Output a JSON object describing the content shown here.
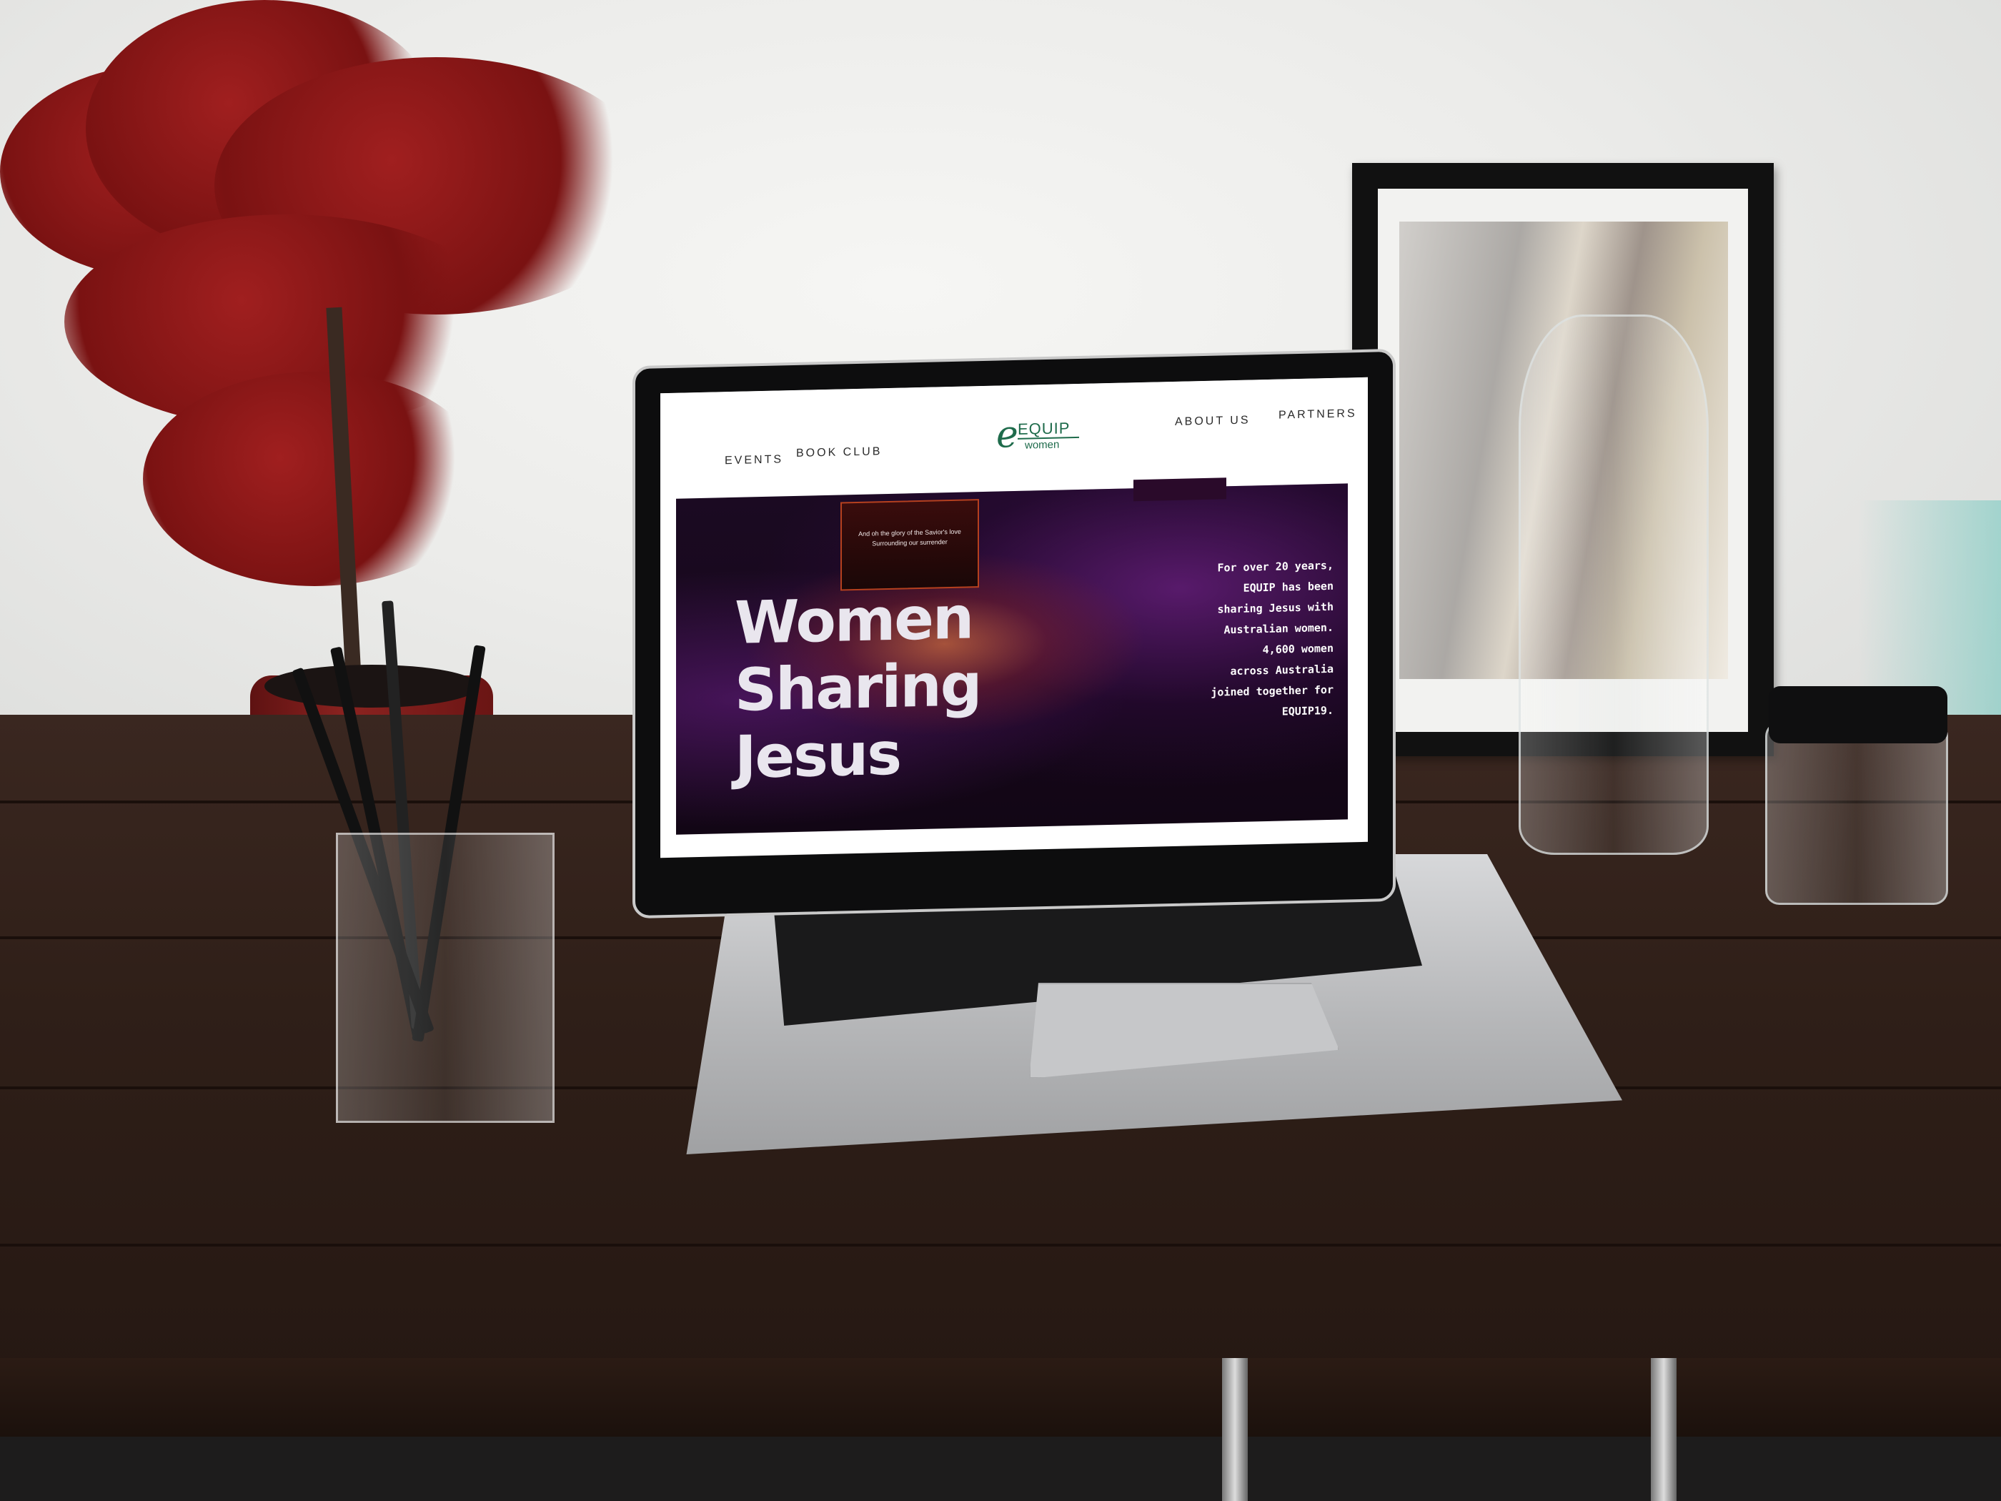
{
  "colors": {
    "brand_green": "#1e6b4b",
    "nav_text": "#2a2a2a",
    "hero_background": "#1b0a22",
    "hero_text": "#e9e6ee"
  },
  "site": {
    "nav_left": [
      "EVENTS",
      "BOOK CLUB"
    ],
    "nav_right": [
      "ABOUT US",
      "PARTNERS"
    ],
    "logo": {
      "wordmark": "EQUIP",
      "sub": "women",
      "icon": "equip-women-logo-icon"
    },
    "hero": {
      "title_lines": [
        "Women",
        "Sharing",
        "Jesus"
      ],
      "stage_lyric_1": "And oh the glory of the Savior's love",
      "stage_lyric_2": "Surrounding our surrender",
      "body_lines": [
        "For over 20 years,",
        "EQUIP has been",
        "sharing Jesus with",
        "Australian women.",
        "4,600 women",
        "across Australia",
        "joined together for",
        "EQUIP19."
      ]
    }
  }
}
